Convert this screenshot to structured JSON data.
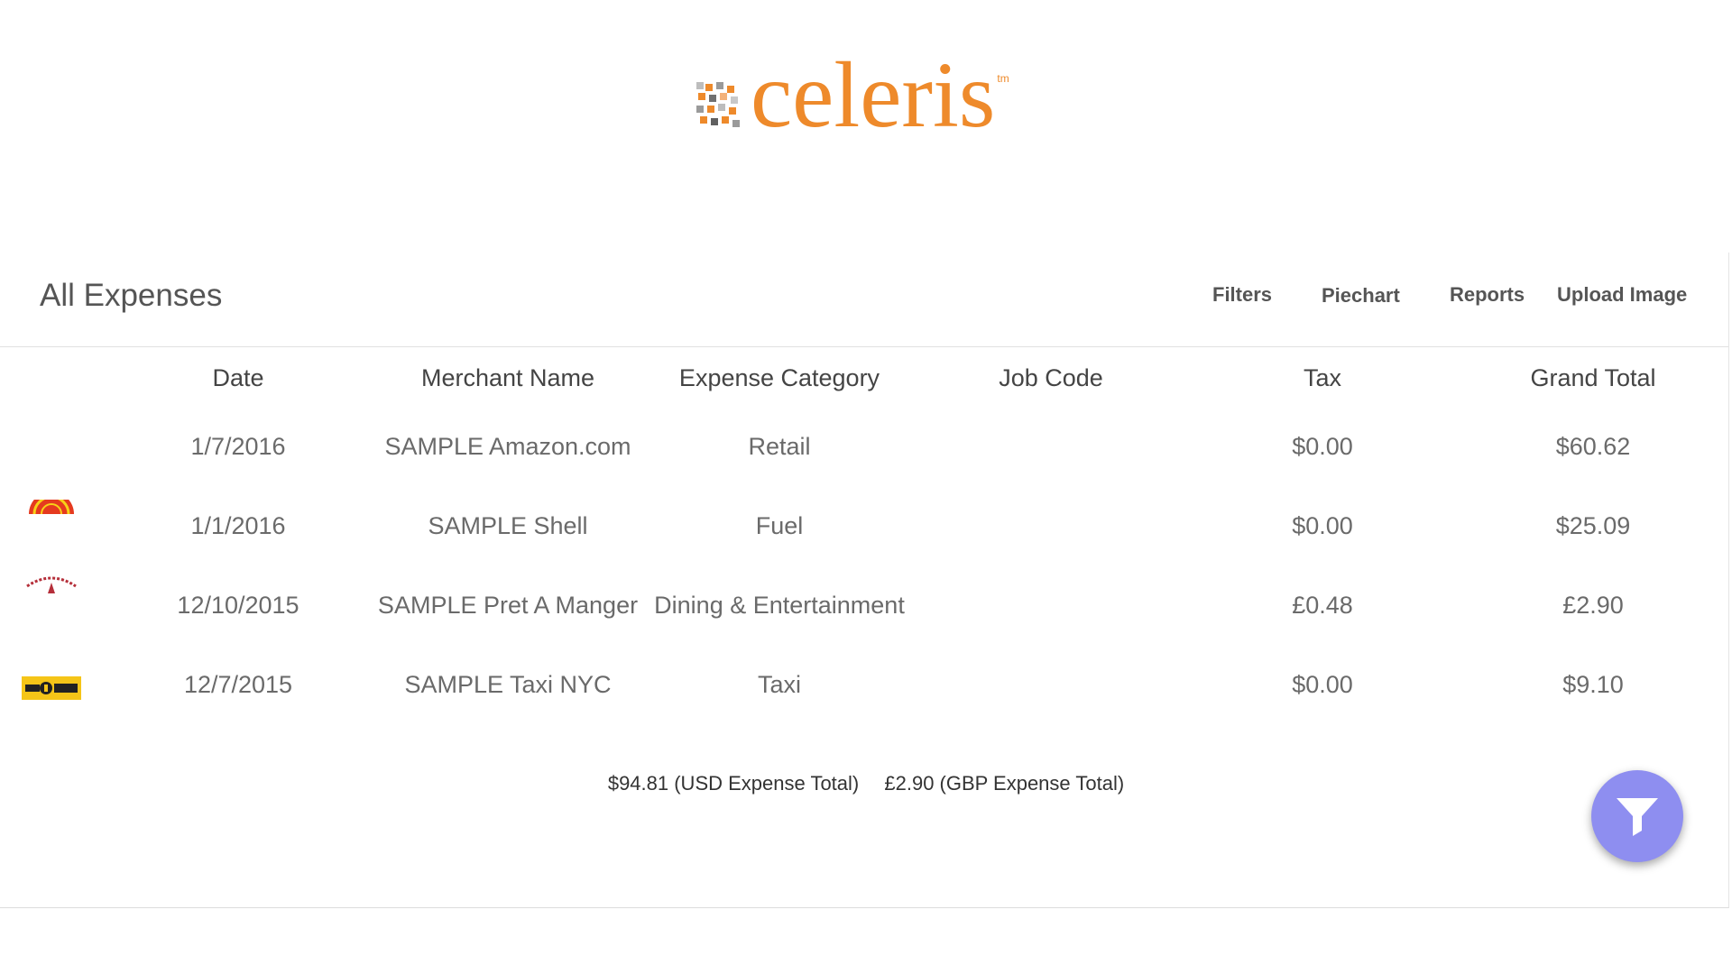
{
  "brand": {
    "name": "celeris",
    "tm": "tm",
    "color": "#ee8a2b"
  },
  "page": {
    "title": "All Expenses"
  },
  "actions": [
    {
      "label": "Filters"
    },
    {
      "label": "Piechart"
    },
    {
      "label": "Reports"
    },
    {
      "label": "Upload Image"
    }
  ],
  "table": {
    "headers": [
      "Date",
      "Merchant Name",
      "Expense Category",
      "Job Code",
      "Tax",
      "Grand Total"
    ],
    "rows": [
      {
        "icon": "",
        "date": "1/7/2016",
        "merchant": "SAMPLE Amazon.com",
        "category": "Retail",
        "job_code": "",
        "tax": "$0.00",
        "total": "$60.62"
      },
      {
        "icon": "shell-logo-icon",
        "date": "1/1/2016",
        "merchant": "SAMPLE Shell",
        "category": "Fuel",
        "job_code": "",
        "tax": "$0.00",
        "total": "$25.09"
      },
      {
        "icon": "organic-coffee-logo-icon",
        "date": "12/10/2015",
        "merchant": "SAMPLE Pret A Manger",
        "category": "Dining & Entertainment",
        "job_code": "",
        "tax": "£0.48",
        "total": "£2.90"
      },
      {
        "icon": "nyc-taxi-logo-icon",
        "date": "12/7/2015",
        "merchant": "SAMPLE Taxi NYC",
        "category": "Taxi",
        "job_code": "",
        "tax": "$0.00",
        "total": "$9.10"
      }
    ]
  },
  "totals": {
    "usd": "$94.81 (USD Expense Total)",
    "gbp": "£2.90 (GBP Expense Total)"
  },
  "fab": {
    "icon": "filter-icon",
    "color": "#8e8ef0"
  }
}
